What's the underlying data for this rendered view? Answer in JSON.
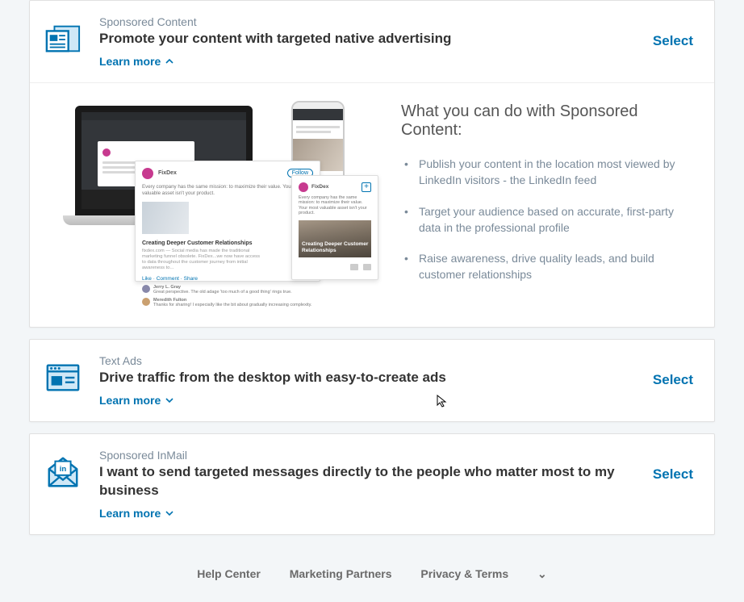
{
  "cards": [
    {
      "eyebrow": "Sponsored Content",
      "headline": "Promote your content with targeted native advertising",
      "learn_more": "Learn more",
      "select": "Select",
      "expanded": true,
      "info_title": "What you can do with Sponsored Content:",
      "bullets": [
        "Publish your content in the location most viewed by LinkedIn visitors - the LinkedIn feed",
        "Target your audience based on accurate, first-party data in the professional profile",
        "Raise awareness, drive quality leads, and build customer relationships"
      ],
      "illus": {
        "brand": "FixDex",
        "follow": "Follow",
        "tagline": "Every company has the same mission: to maximize their value. Your most valuable asset isn't your product.",
        "article_title": "Creating Deeper Customer Relationships",
        "article_sub": "fixdex.com — Social media has made the traditional marketing funnel obsolete. FixDex...we now have access to data throughout the customer journey from initial awareness to...",
        "actions": "Like · Comment · Share",
        "c1_name": "Jerry L. Gray",
        "c1_text": "Great perspective. The old adage 'too much of a good thing' rings true.",
        "c2_name": "Meredith Fulton",
        "c2_text": "Thanks for sharing! I especially like the bit about gradually increasing complexity.",
        "hero_text": "Creating Deeper Customer Relationships"
      }
    },
    {
      "eyebrow": "Text Ads",
      "headline": "Drive traffic from the desktop with easy-to-create ads",
      "learn_more": "Learn more",
      "select": "Select",
      "expanded": false
    },
    {
      "eyebrow": "Sponsored InMail",
      "headline": "I want to send targeted messages directly to the people who matter most to my business",
      "learn_more": "Learn more",
      "select": "Select",
      "expanded": false
    }
  ],
  "footer": {
    "help": "Help Center",
    "partners": "Marketing Partners",
    "privacy": "Privacy & Terms"
  },
  "colors": {
    "accent": "#0073b1"
  }
}
